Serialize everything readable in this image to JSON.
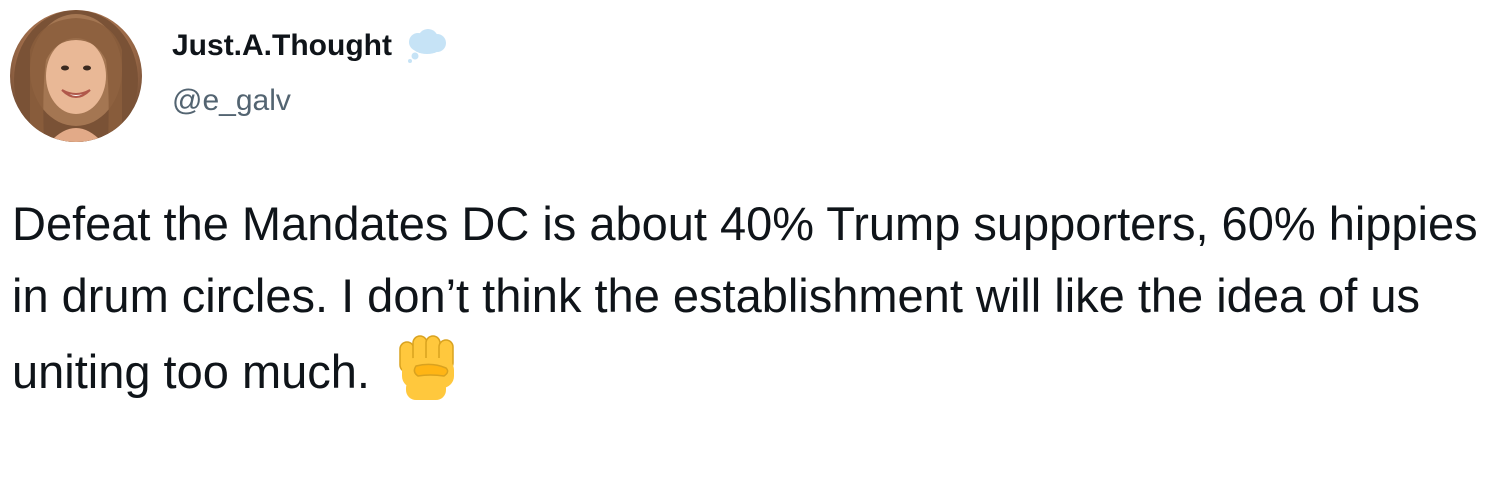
{
  "tweet": {
    "display_name": "Just.A.Thought",
    "name_emoji": "thought-balloon-icon",
    "handle": "@e_galv",
    "text": "Defeat the Mandates DC is about 40% Trump supporters, 60% hippies in drum circles. I don’t think the establishment will like the idea of us uniting too much.",
    "text_emoji": "raised-fist-icon"
  },
  "colors": {
    "text": "#0f1419",
    "handle": "#536471",
    "emoji_blue": "#c6e3f6",
    "emoji_yellow": "#ffc83d"
  }
}
